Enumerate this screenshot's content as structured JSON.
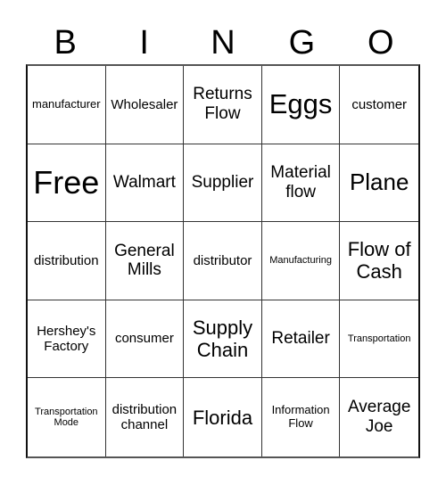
{
  "header": {
    "letters": [
      "B",
      "I",
      "N",
      "G",
      "O"
    ]
  },
  "board": {
    "rows": [
      [
        "manufacturer",
        "Wholesaler",
        "Returns Flow",
        "Eggs",
        "customer"
      ],
      [
        "Free",
        "Walmart",
        "Supplier",
        "Material flow",
        "Plane"
      ],
      [
        "distribution",
        "General Mills",
        "distributor",
        "Manufacturing",
        "Flow of Cash"
      ],
      [
        "Hershey's Factory",
        "consumer",
        "Supply Chain",
        "Retailer",
        "Transportation"
      ],
      [
        "Transportation Mode",
        "distribution channel",
        "Florida",
        "Information Flow",
        "Average Joe"
      ]
    ]
  }
}
